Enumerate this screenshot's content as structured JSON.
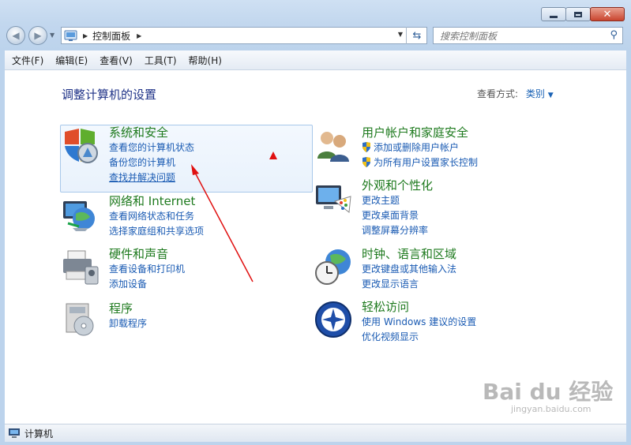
{
  "window": {
    "controls": {
      "minimize_icon": "minimize-icon",
      "maximize_icon": "maximize-icon",
      "close_icon": "close-icon"
    }
  },
  "navigation": {
    "breadcrumb": [
      "控制面板"
    ],
    "search_placeholder": "搜索控制面板"
  },
  "menubar": {
    "items": [
      "文件(F)",
      "编辑(E)",
      "查看(V)",
      "工具(T)",
      "帮助(H)"
    ]
  },
  "main": {
    "heading": "调整计算机的设置",
    "view_by_label": "查看方式:",
    "view_by_value": "类别",
    "categories_left": [
      {
        "title": "系统和安全",
        "icon": "shield-icon",
        "links": [
          "查看您的计算机状态",
          "备份您的计算机",
          "查找并解决问题"
        ]
      },
      {
        "title": "网络和 Internet",
        "icon": "network-globe-icon",
        "links": [
          "查看网络状态和任务",
          "选择家庭组和共享选项"
        ]
      },
      {
        "title": "硬件和声音",
        "icon": "printer-icon",
        "links": [
          "查看设备和打印机",
          "添加设备"
        ]
      },
      {
        "title": "程序",
        "icon": "programs-icon",
        "links": [
          "卸载程序"
        ]
      }
    ],
    "categories_right": [
      {
        "title": "用户帐户和家庭安全",
        "icon": "users-icon",
        "links": [
          "添加或删除用户帐户",
          "为所有用户设置家长控制"
        ]
      },
      {
        "title": "外观和个性化",
        "icon": "monitor-palette-icon",
        "links": [
          "更改主题",
          "更改桌面背景",
          "调整屏幕分辨率"
        ]
      },
      {
        "title": "时钟、语言和区域",
        "icon": "clock-globe-icon",
        "links": [
          "更改键盘或其他输入法",
          "更改显示语言"
        ]
      },
      {
        "title": "轻松访问",
        "icon": "ease-of-access-icon",
        "links": [
          "使用 Windows 建议的设置",
          "优化视频显示"
        ]
      }
    ]
  },
  "statusbar": {
    "text": "计算机",
    "icon": "computer-icon"
  },
  "watermark": {
    "text": "Bai du 经验",
    "subtext": "jingyan.baidu.com"
  },
  "colors": {
    "title_green": "#1e7a1e",
    "link_blue": "#1a5bb3",
    "heading_blue": "#1e3287",
    "annotation_red": "#e01010"
  }
}
